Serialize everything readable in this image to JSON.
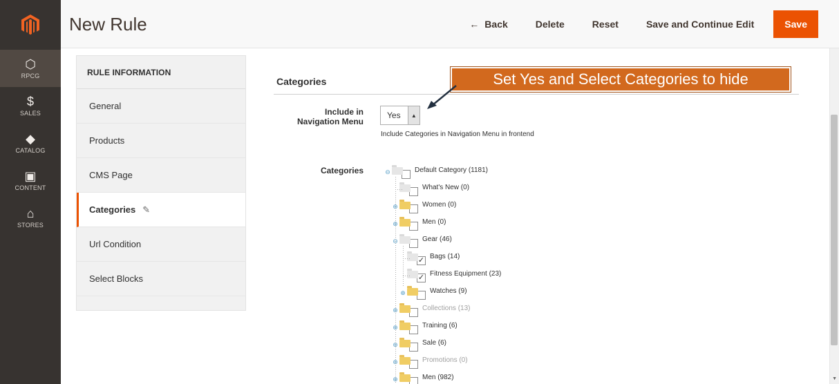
{
  "nav": {
    "logo_icon": "magento-logo-icon",
    "items": [
      {
        "icon": "⬡",
        "label": "RPCG",
        "active": true
      },
      {
        "icon": "$",
        "label": "SALES"
      },
      {
        "icon": "◆",
        "label": "CATALOG"
      },
      {
        "icon": "▣",
        "label": "CONTENT"
      },
      {
        "icon": "⌂",
        "label": "STORES"
      }
    ]
  },
  "header": {
    "title": "New Rule",
    "back_arrow": "←",
    "back": "Back",
    "delete": "Delete",
    "reset": "Reset",
    "save_continue": "Save and Continue Edit",
    "save": "Save"
  },
  "tabs": {
    "heading": "RULE INFORMATION",
    "items": [
      {
        "label": "General"
      },
      {
        "label": "Products"
      },
      {
        "label": "CMS Page"
      },
      {
        "label": "Categories",
        "active": true
      },
      {
        "label": "Url Condition"
      },
      {
        "label": "Select Blocks"
      }
    ]
  },
  "section": {
    "title": "Categories",
    "annotation": "Set Yes and Select Categories to hide",
    "include_label_1": "Include in",
    "include_label_2": "Navigation Menu",
    "include_value": "Yes",
    "include_note": "Include Categories in Navigation Menu in frontend",
    "categories_label": "Categories"
  },
  "tree": [
    {
      "label": "Default Category (1181)",
      "level": 0,
      "expander": "minus",
      "open": true,
      "checked": false
    },
    {
      "label": "What's New (0)",
      "level": 1,
      "expander": "none",
      "open": true,
      "checked": false
    },
    {
      "label": "Women (0)",
      "level": 1,
      "expander": "plus",
      "open": false,
      "checked": false
    },
    {
      "label": "Men (0)",
      "level": 1,
      "expander": "plus",
      "open": false,
      "checked": false
    },
    {
      "label": "Gear (46)",
      "level": 1,
      "expander": "minus",
      "open": true,
      "checked": false
    },
    {
      "label": "Bags (14)",
      "level": 2,
      "expander": "none",
      "open": true,
      "checked": true
    },
    {
      "label": "Fitness Equipment (23)",
      "level": 2,
      "expander": "none",
      "open": true,
      "checked": true
    },
    {
      "label": "Watches (9)",
      "level": 2,
      "expander": "plus",
      "open": false,
      "checked": false
    },
    {
      "label": "Collections (13)",
      "level": 1,
      "expander": "plus",
      "open": false,
      "checked": false,
      "disabled": true
    },
    {
      "label": "Training (6)",
      "level": 1,
      "expander": "plus",
      "open": false,
      "checked": false
    },
    {
      "label": "Sale (6)",
      "level": 1,
      "expander": "plus",
      "open": false,
      "checked": false
    },
    {
      "label": "Promotions (0)",
      "level": 1,
      "expander": "plus",
      "open": false,
      "checked": false,
      "disabled": true
    },
    {
      "label": "Men (982)",
      "level": 1,
      "expander": "plus",
      "open": false,
      "checked": false
    }
  ],
  "glyphs": {
    "check": "✓",
    "plus": "⊕",
    "minus": "⊖",
    "pencil": "✎",
    "caret_up": "▲",
    "scroll_down": "▼"
  },
  "colors": {
    "accent": "#eb5202",
    "nav_bg": "#373330",
    "annotation_bg": "#d2691e"
  }
}
